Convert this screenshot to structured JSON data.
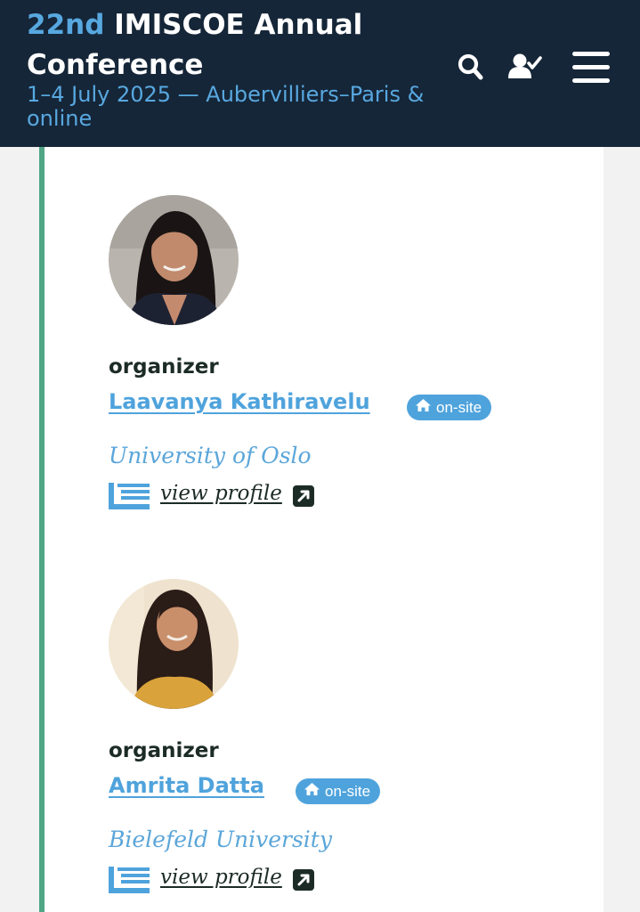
{
  "header": {
    "title_accent": "22nd",
    "title_rest": "IMISCOE Annual Conference",
    "subtitle": "1–4 July 2025 — Aubervilliers–Paris & online",
    "icons": [
      "search-icon",
      "user-check-icon",
      "menu-icon"
    ]
  },
  "people": [
    {
      "role": "organizer",
      "name": "Laavanya Kathiravelu",
      "badge": "on-site",
      "affiliation": "University of Oslo",
      "profile_link": "view profile"
    },
    {
      "role": "organizer",
      "name": "Amrita Datta",
      "badge": "on-site",
      "affiliation": "Bielefeld University",
      "profile_link": "view profile"
    }
  ],
  "colors": {
    "header_bg": "#152638",
    "accent_blue": "#4fa3dc",
    "green_border": "#4fa585",
    "text_dark": "#1c2b26"
  }
}
